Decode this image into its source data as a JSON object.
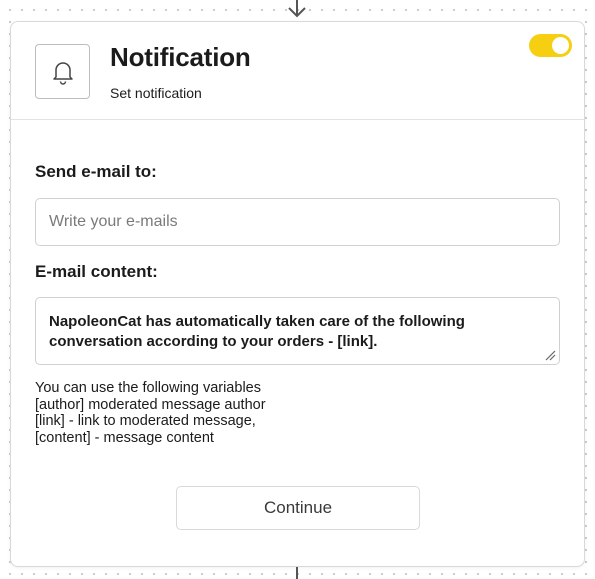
{
  "icons": {
    "connector": "arrow-down-icon",
    "node": "bell-icon",
    "resize": "resize-handle-icon"
  },
  "colors": {
    "toggle_on": "#f6cf12",
    "dot_grid": "#c9c9c9"
  },
  "node": {
    "title": "Notification",
    "subtitle": "Set notification",
    "enabled": true
  },
  "form": {
    "email_label": "Send e-mail to:",
    "email_placeholder": "Write your e-mails",
    "email_value": "",
    "content_label": "E-mail content:",
    "content_value": "NapoleonCat has automatically taken care of the following conversation according to your orders - [link]."
  },
  "variables": {
    "lines": [
      "You can use the following variables",
      "[author] moderated message author",
      "[link] - link to moderated message,",
      "[content] - message content"
    ]
  },
  "actions": {
    "continue_label": "Continue"
  }
}
